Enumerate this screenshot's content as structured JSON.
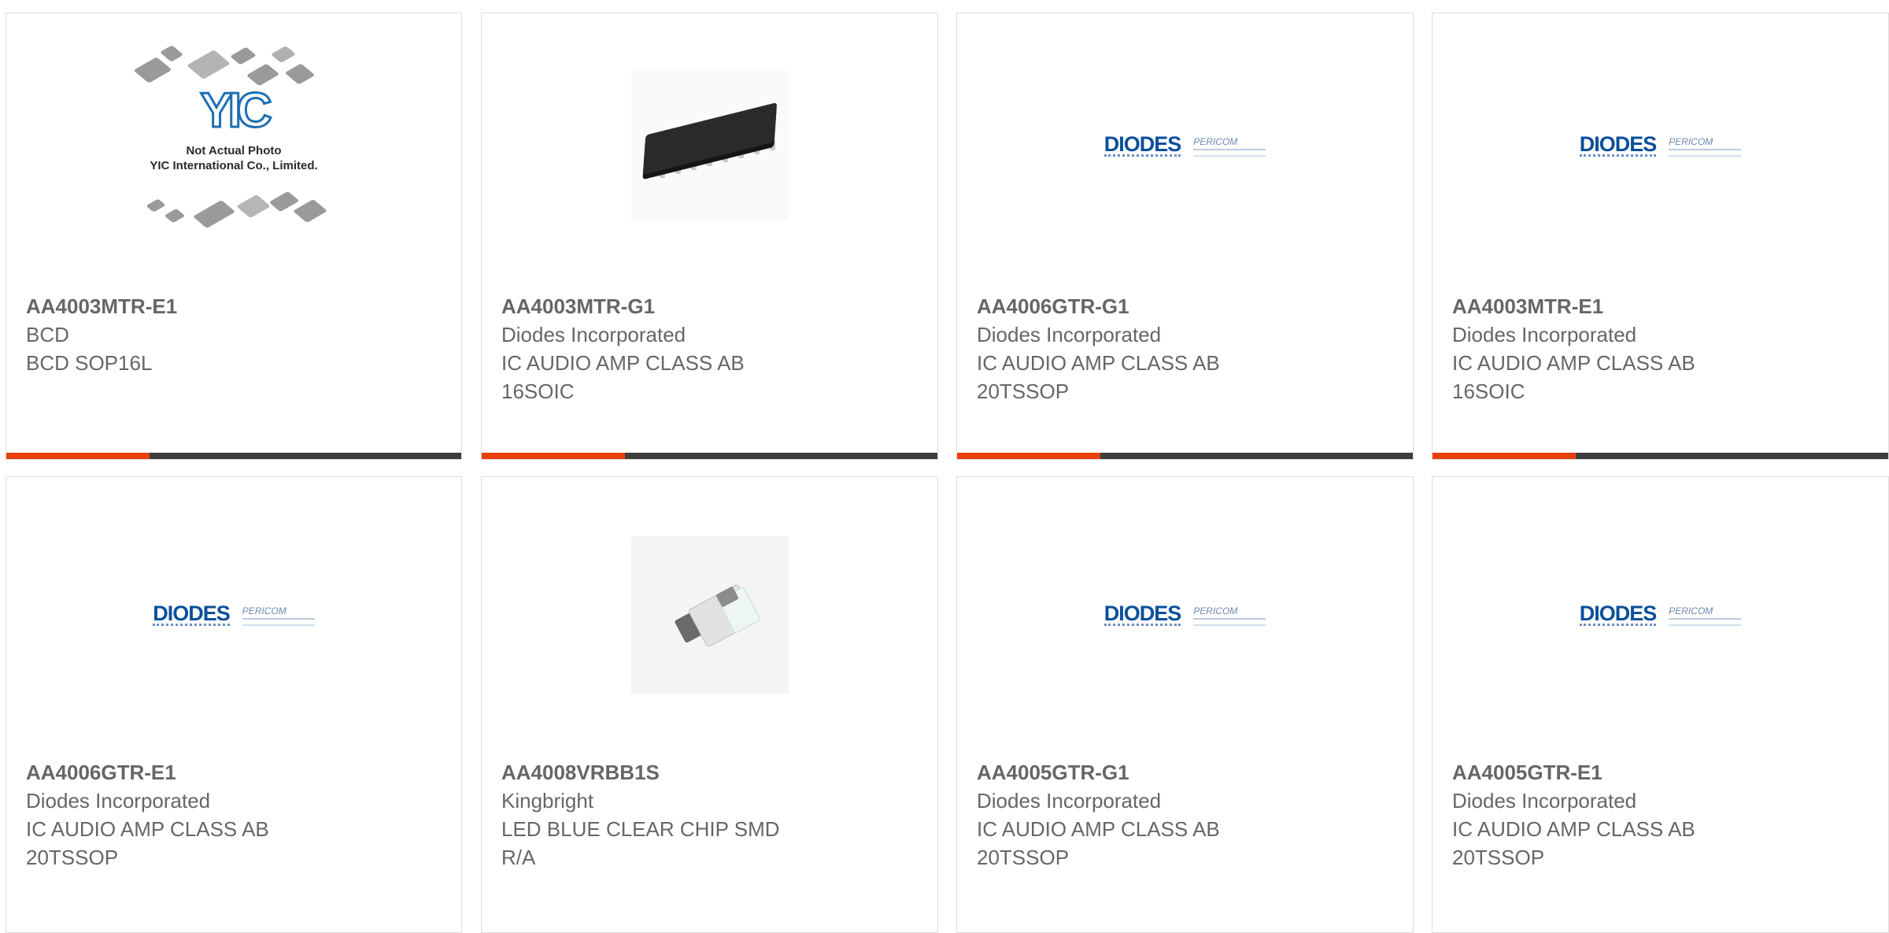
{
  "colors": {
    "accent": "#e8400c",
    "bar": "#3d3d3d",
    "diodes_blue": "#0b4f9c"
  },
  "products": [
    {
      "part": "AA4003MTR-E1",
      "maker": "BCD",
      "desc": "BCD SOP16L",
      "desc2": "",
      "image": "yic-placeholder",
      "placeholder": {
        "brand": "YIC",
        "caption1": "Not Actual Photo",
        "caption2": "YIC International Co., Limited."
      }
    },
    {
      "part": "AA4003MTR-G1",
      "maker": "Diodes Incorporated",
      "desc": "IC AUDIO AMP CLASS AB",
      "desc2": "16SOIC",
      "image": "soic-chip"
    },
    {
      "part": "AA4006GTR-G1",
      "maker": "Diodes Incorporated",
      "desc": "IC AUDIO AMP CLASS AB",
      "desc2": "20TSSOP",
      "image": "diodes-logo"
    },
    {
      "part": "AA4003MTR-E1",
      "maker": "Diodes Incorporated",
      "desc": "IC AUDIO AMP CLASS AB",
      "desc2": "16SOIC",
      "image": "diodes-logo"
    },
    {
      "part": "AA4006GTR-E1",
      "maker": "Diodes Incorporated",
      "desc": "IC AUDIO AMP CLASS AB",
      "desc2": "20TSSOP",
      "image": "diodes-logo"
    },
    {
      "part": "AA4008VRBB1S",
      "maker": "Kingbright",
      "desc": "LED BLUE CLEAR CHIP SMD",
      "desc2": "R/A",
      "image": "led-chip"
    },
    {
      "part": "AA4005GTR-G1",
      "maker": "Diodes Incorporated",
      "desc": "IC AUDIO AMP CLASS AB",
      "desc2": "20TSSOP",
      "image": "diodes-logo"
    },
    {
      "part": "AA4005GTR-E1",
      "maker": "Diodes Incorporated",
      "desc": "IC AUDIO AMP CLASS AB",
      "desc2": "20TSSOP",
      "image": "diodes-logo"
    }
  ],
  "logo": {
    "diodes": "DIODES",
    "pericom": "PERICOM"
  }
}
